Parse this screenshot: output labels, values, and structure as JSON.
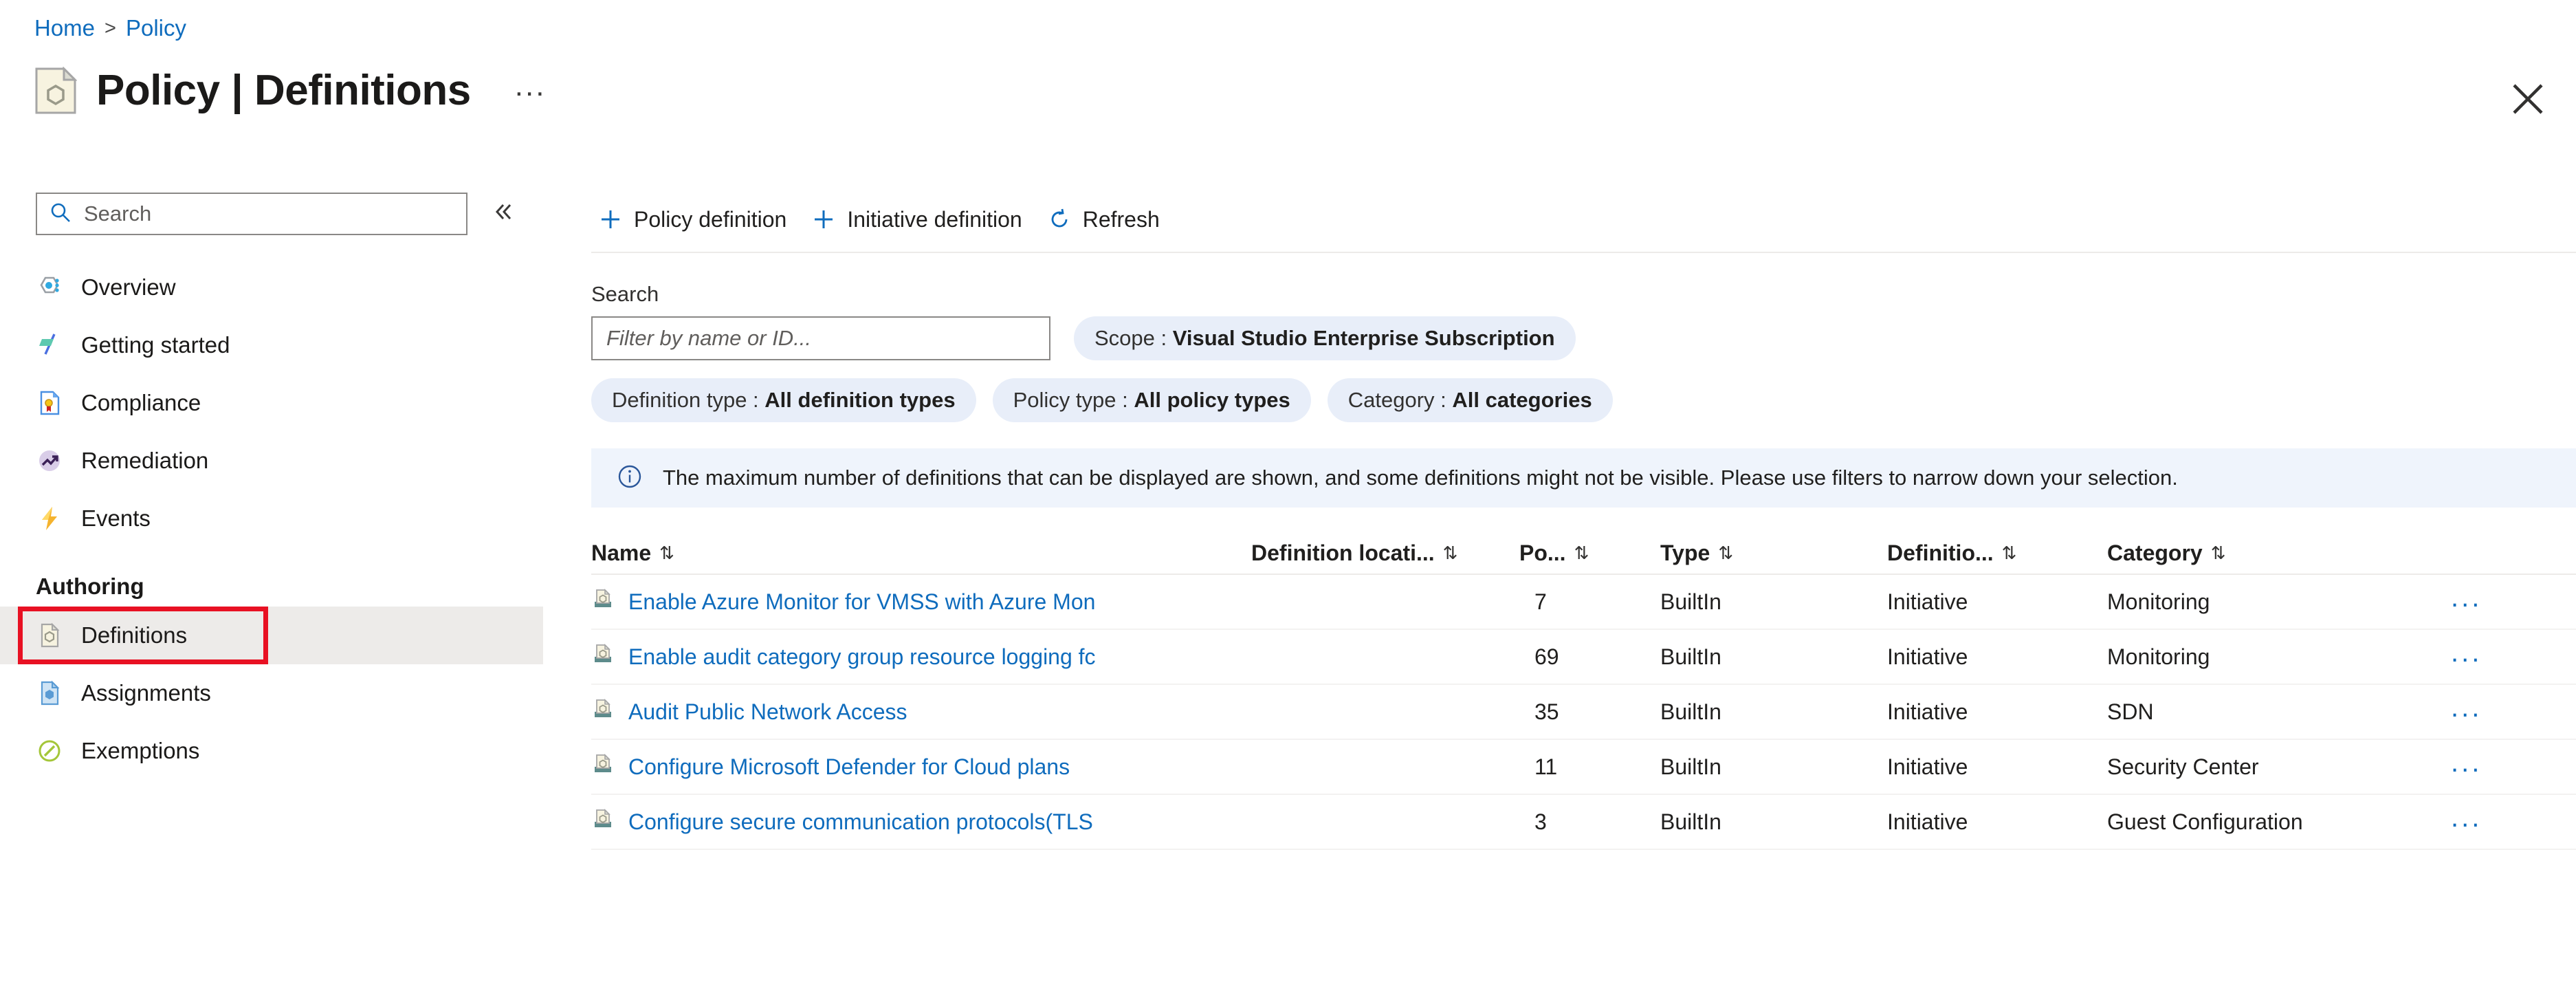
{
  "breadcrumb": {
    "home": "Home",
    "separator": ">",
    "current": "Policy"
  },
  "header": {
    "title": "Policy | Definitions",
    "title_icon": "policy-document-icon",
    "more_menu": "...",
    "close_icon": "close-icon"
  },
  "sidebar": {
    "search_placeholder": "Search",
    "search_icon": "search-icon",
    "collapse_icon": "chevron-double-left-icon",
    "items": [
      {
        "label": "Overview",
        "icon": "overview-hexagon-icon",
        "selected": false
      },
      {
        "label": "Getting started",
        "icon": "flag-icon",
        "selected": false
      },
      {
        "label": "Compliance",
        "icon": "compliance-ribbon-icon",
        "selected": false
      },
      {
        "label": "Remediation",
        "icon": "trend-arrow-icon",
        "selected": false
      },
      {
        "label": "Events",
        "icon": "lightning-bolt-icon",
        "selected": false
      }
    ],
    "section_label": "Authoring",
    "authoring_items": [
      {
        "label": "Definitions",
        "icon": "definition-document-icon",
        "selected": true
      },
      {
        "label": "Assignments",
        "icon": "assignment-document-icon",
        "selected": false
      },
      {
        "label": "Exemptions",
        "icon": "exemption-circle-icon",
        "selected": false
      }
    ]
  },
  "toolbar": {
    "policy_definition": "Policy definition",
    "initiative_definition": "Initiative definition",
    "refresh": "Refresh",
    "plus_icon": "plus-icon",
    "refresh_icon": "refresh-icon"
  },
  "filters": {
    "search_label": "Search",
    "search_placeholder": "Filter by name or ID...",
    "pills": [
      {
        "label": "Scope :",
        "value": "Visual Studio Enterprise Subscription"
      },
      {
        "label": "Definition type :",
        "value": "All definition types"
      },
      {
        "label": "Policy type :",
        "value": "All policy types"
      },
      {
        "label": "Category :",
        "value": "All categories"
      }
    ]
  },
  "banner": {
    "icon": "info-icon",
    "text": "The maximum number of definitions that can be displayed are shown, and some definitions might not be visible. Please use filters to narrow down your selection."
  },
  "table": {
    "columns": [
      {
        "label": "Name",
        "sort": "⇅"
      },
      {
        "label": "Definition locati...",
        "sort": "⇅"
      },
      {
        "label": "Po...",
        "sort": "⇅"
      },
      {
        "label": "Type",
        "sort": "⇅"
      },
      {
        "label": "Definitio...",
        "sort": "⇅"
      },
      {
        "label": "Category",
        "sort": "⇅"
      }
    ],
    "row_icon": "initiative-icon",
    "row_menu": "...",
    "rows": [
      {
        "name": "Enable Azure Monitor for VMSS with Azure Mon",
        "location": "",
        "policies": "7",
        "type": "BuiltIn",
        "definition_type": "Initiative",
        "category": "Monitoring"
      },
      {
        "name": "Enable audit category group resource logging fc",
        "location": "",
        "policies": "69",
        "type": "BuiltIn",
        "definition_type": "Initiative",
        "category": "Monitoring"
      },
      {
        "name": "Audit Public Network Access",
        "location": "",
        "policies": "35",
        "type": "BuiltIn",
        "definition_type": "Initiative",
        "category": "SDN"
      },
      {
        "name": "Configure Microsoft Defender for Cloud plans",
        "location": "",
        "policies": "11",
        "type": "BuiltIn",
        "definition_type": "Initiative",
        "category": "Security Center"
      },
      {
        "name": "Configure secure communication protocols(TLS",
        "location": "",
        "policies": "3",
        "type": "BuiltIn",
        "definition_type": "Initiative",
        "category": "Guest Configuration"
      }
    ]
  },
  "colors": {
    "link": "#0f6cbd",
    "pill_bg": "#e8eef9",
    "banner_bg": "#eff4fc",
    "highlight": "#e81123",
    "selected_row": "#edebe9"
  }
}
